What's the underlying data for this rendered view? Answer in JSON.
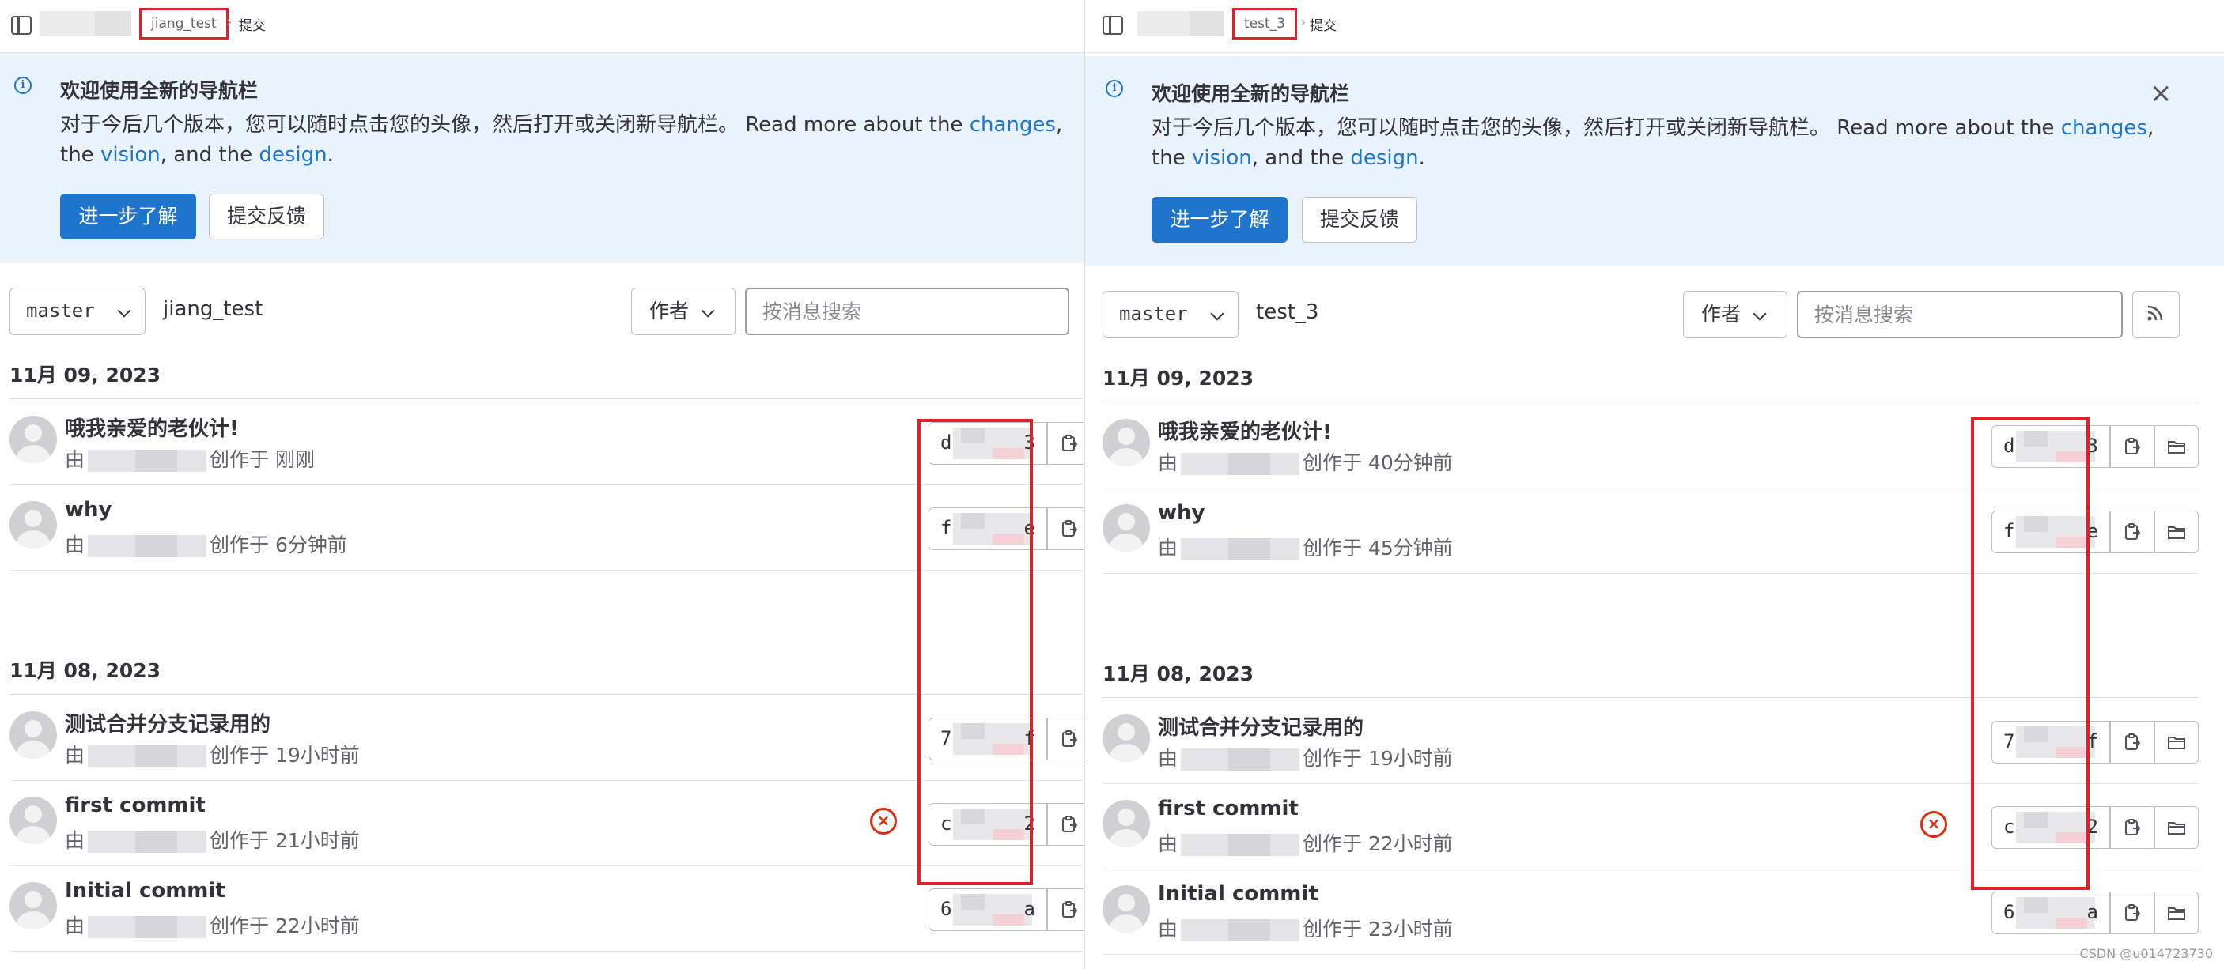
{
  "left": {
    "breadcrumb": {
      "project": "jiang_test",
      "current": "提交"
    },
    "banner": {
      "title": "欢迎使用全新的导航栏",
      "body_prefix": "对于今后几个版本，您可以随时点击您的头像，然后打开或关闭新导航栏。 Read more about the ",
      "link_changes": "changes",
      "sep1": ", the ",
      "link_vision": "vision",
      "sep2": ", and the ",
      "link_design": "design",
      "end": ".",
      "learn_more": "进一步了解",
      "feedback": "提交反馈"
    },
    "filters": {
      "branch": "master",
      "repo": "jiang_test",
      "author": "作者",
      "search_placeholder": "按消息搜索"
    },
    "groups": [
      {
        "date": "11月 09, 2023",
        "commits": [
          {
            "title": "哦我亲爱的老伙计!",
            "by": "由",
            "created": "创作于 刚刚",
            "sha_head": "d8",
            "sha_tail": "3"
          },
          {
            "title": "why",
            "by": "由",
            "created": "创作于 6分钟前",
            "sha_head": "f0",
            "sha_tail": "e"
          }
        ]
      },
      {
        "date": "11月 08, 2023",
        "commits": [
          {
            "title": "测试合并分支记录用的",
            "by": "由",
            "created": "创作于 19小时前",
            "sha_head": "73",
            "sha_tail": "f"
          },
          {
            "title": "first commit",
            "by": "由",
            "created": "创作于 21小时前",
            "sha_head": "c9",
            "sha_tail": "2"
          },
          {
            "title": "Initial commit",
            "by": "由",
            "created": "创作于 22小时前",
            "sha_head": "65",
            "sha_tail": "a"
          }
        ]
      }
    ]
  },
  "right": {
    "breadcrumb": {
      "project": "test_3",
      "current": "提交"
    },
    "banner": {
      "title": "欢迎使用全新的导航栏",
      "body_prefix": "对于今后几个版本，您可以随时点击您的头像，然后打开或关闭新导航栏。 Read more about the ",
      "link_changes": "changes",
      "sep1": ", the ",
      "link_vision": "vision",
      "sep2": ", and the ",
      "link_design": "design",
      "end": ".",
      "learn_more": "进一步了解",
      "feedback": "提交反馈"
    },
    "filters": {
      "branch": "master",
      "repo": "test_3",
      "author": "作者",
      "search_placeholder": "按消息搜索"
    },
    "groups": [
      {
        "date": "11月 09, 2023",
        "commits": [
          {
            "title": "哦我亲爱的老伙计!",
            "by": "由",
            "created": "创作于 40分钟前",
            "sha_head": "d",
            "sha_tail": "3"
          },
          {
            "title": "why",
            "by": "由",
            "created": "创作于 45分钟前",
            "sha_head": "f",
            "sha_tail": "e"
          }
        ]
      },
      {
        "date": "11月 08, 2023",
        "commits": [
          {
            "title": "测试合并分支记录用的",
            "by": "由",
            "created": "创作于 19小时前",
            "sha_head": "7",
            "sha_tail": "f"
          },
          {
            "title": "first commit",
            "by": "由",
            "created": "创作于 22小时前",
            "sha_head": "c",
            "sha_tail": "2"
          },
          {
            "title": "Initial commit",
            "by": "由",
            "created": "创作于 23小时前",
            "sha_head": "6",
            "sha_tail": "a"
          }
        ]
      }
    ]
  },
  "watermark": "CSDN @u014723730",
  "icons": {
    "sidebar_toggle": "sidebar-icon",
    "info": "info-icon",
    "close": "close-icon",
    "chevron": "chevron-down-icon",
    "rss": "rss-icon",
    "copy": "copy-icon",
    "browse": "folder-icon",
    "failed": "status-failed-icon"
  },
  "colors": {
    "primary": "#1f75cb",
    "banner_bg": "#e9f3fc",
    "failed": "#dd2b0e",
    "highlight": "#e0202a"
  }
}
